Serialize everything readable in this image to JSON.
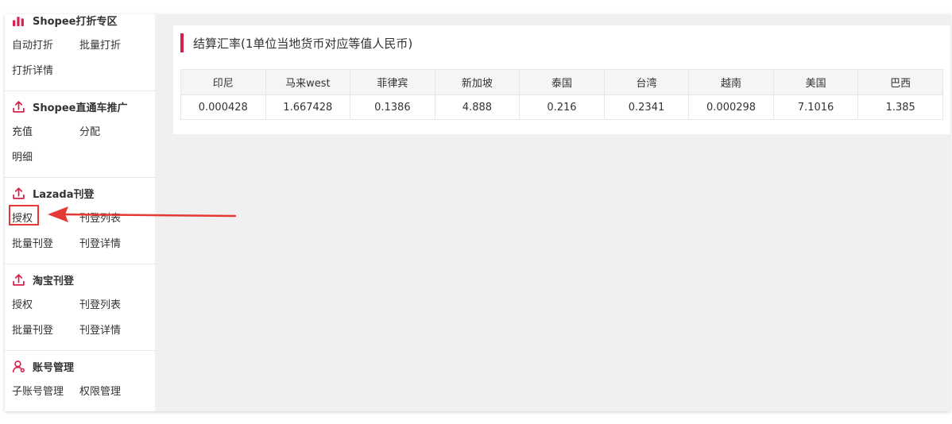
{
  "sidebar": {
    "sections": [
      {
        "title": "Shopee打折专区",
        "icon": "bar-chart-icon",
        "links": [
          "自动打折",
          "批量打折",
          "打折详情"
        ]
      },
      {
        "title": "Shopee直通车推广",
        "icon": "upload-icon",
        "links": [
          "充值",
          "分配",
          "明细"
        ]
      },
      {
        "title": "Lazada刊登",
        "icon": "upload-icon",
        "links": [
          "授权",
          "刊登列表",
          "批量刊登",
          "刊登详情"
        ]
      },
      {
        "title": "淘宝刊登",
        "icon": "upload-icon",
        "links": [
          "授权",
          "刊登列表",
          "批量刊登",
          "刊登详情"
        ]
      },
      {
        "title": "账号管理",
        "icon": "user-icon",
        "links": [
          "子账号管理",
          "权限管理"
        ]
      }
    ]
  },
  "main": {
    "title": "结算汇率(1单位当地货币对应等值人民币)",
    "table": {
      "headers": [
        "印尼",
        "马来west",
        "菲律宾",
        "新加坡",
        "泰国",
        "台湾",
        "越南",
        "美国",
        "巴西"
      ],
      "rows": [
        [
          "0.000428",
          "1.667428",
          "0.1386",
          "4.888",
          "0.216",
          "0.2341",
          "0.000298",
          "7.1016",
          "1.385"
        ]
      ]
    }
  },
  "colors": {
    "accent": "#d81e4b",
    "annotation": "#e53935",
    "icon": "#d81e4b"
  }
}
